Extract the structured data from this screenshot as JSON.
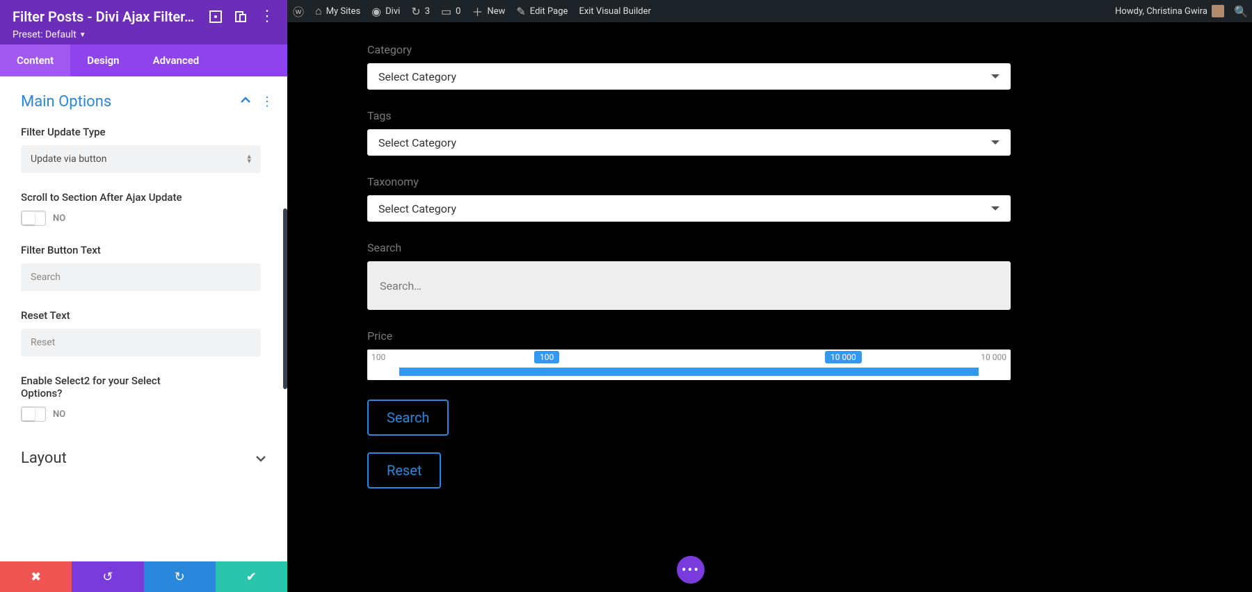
{
  "wp_bar": {
    "my_sites": "My Sites",
    "site_name": "Divi",
    "updates": "3",
    "comments": "0",
    "new": "New",
    "edit_page": "Edit Page",
    "exit_vb": "Exit Visual Builder",
    "greeting": "Howdy, Christina Gwira"
  },
  "sidebar": {
    "title": "Filter Posts - Divi Ajax Filter…",
    "preset": "Preset: Default",
    "tabs": {
      "content": "Content",
      "design": "Design",
      "advanced": "Advanced"
    },
    "sections": {
      "main_options": "Main Options",
      "layout": "Layout"
    },
    "fields": {
      "filter_update_type_label": "Filter Update Type",
      "filter_update_type_value": "Update via button",
      "scroll_after_ajax_label": "Scroll to Section After Ajax Update",
      "scroll_after_ajax_value": "NO",
      "filter_button_text_label": "Filter Button Text",
      "filter_button_text_placeholder": "Search",
      "reset_text_label": "Reset Text",
      "reset_text_placeholder": "Reset",
      "enable_select2_label": "Enable Select2 for your Select Options?",
      "enable_select2_value": "NO"
    }
  },
  "preview": {
    "category_label": "Category",
    "category_value": "Select Category",
    "tags_label": "Tags",
    "tags_value": "Select Category",
    "taxonomy_label": "Taxonomy",
    "taxonomy_value": "Select Category",
    "search_label": "Search",
    "search_placeholder": "Search…",
    "price_label": "Price",
    "price_min": "100",
    "price_max": "10 000",
    "price_badge_a": "100",
    "price_badge_b": "10 000",
    "search_btn": "Search",
    "reset_btn": "Reset"
  }
}
